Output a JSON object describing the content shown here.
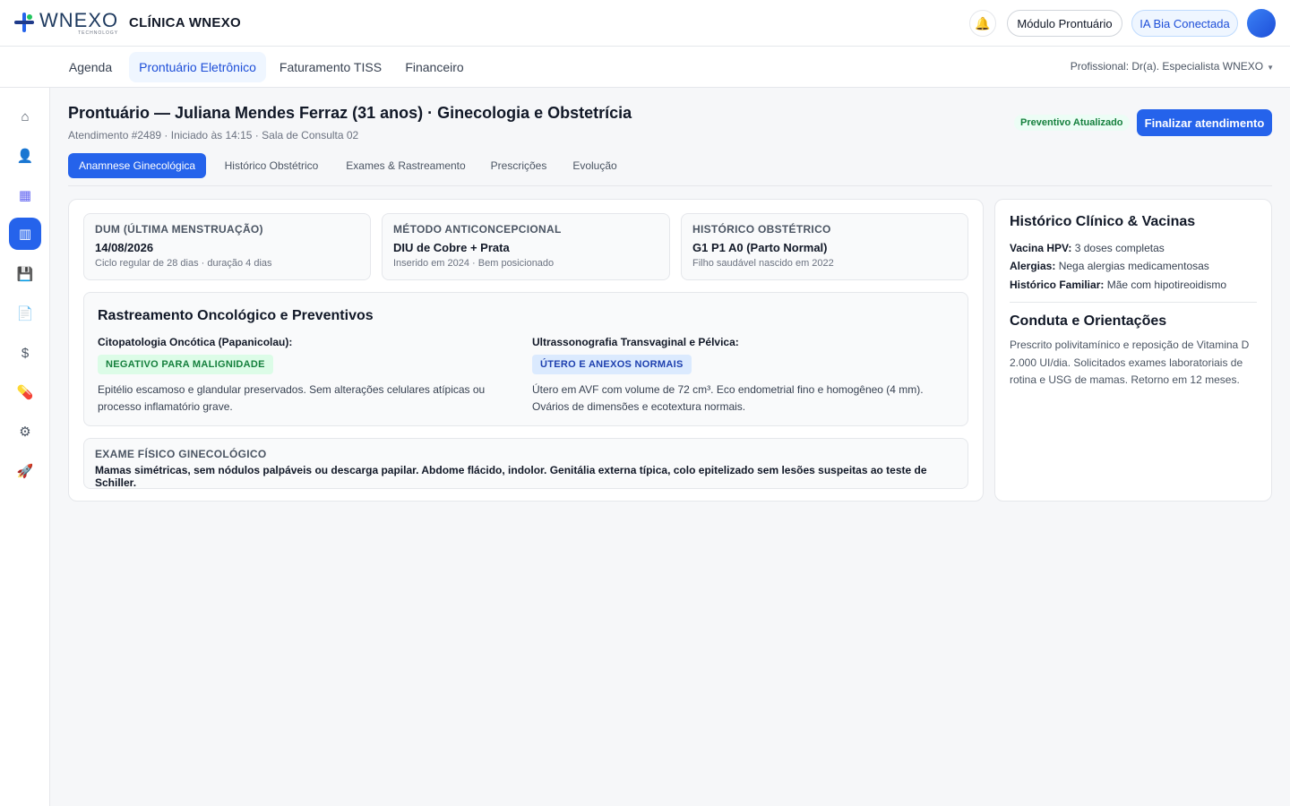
{
  "brand": {
    "logo_word": "WNEXO",
    "logo_sub": "TECHNOLOGY",
    "clinic": "CLÍNICA WNEXO"
  },
  "header": {
    "modulo_label": "Módulo Prontuário",
    "ia_label": "IA Bia Conectada"
  },
  "nav": {
    "items": [
      {
        "label": "Agenda"
      },
      {
        "label": "Prontuário Eletrônico"
      },
      {
        "label": "Faturamento TISS"
      },
      {
        "label": "Financeiro"
      }
    ],
    "profissional": "Profissional: Dr(a). Especialista WNEXO"
  },
  "sidebar": {
    "icons": [
      "home-icon",
      "patient-icon",
      "calendar-icon",
      "records-icon",
      "save-icon",
      "document-icon",
      "dollar-icon",
      "pill-icon",
      "gear-icon",
      "rocket-icon"
    ],
    "glyphs": [
      "⌂",
      "👤",
      "▦",
      "▥",
      "💾",
      "📄",
      "$",
      "💊",
      "⚙",
      "🚀"
    ]
  },
  "patient": {
    "title": "Prontuário — Juliana Mendes Ferraz (31 anos) · Ginecologia e Obstetrícia",
    "subtitle": "Atendimento #2489 · Iniciado às 14:15 · Sala de Consulta 02",
    "status_badge": "Preventivo Atualizado",
    "finalize_label": "Finalizar atendimento"
  },
  "tabs": [
    {
      "label": "Anamnese Ginecológica"
    },
    {
      "label": "Histórico Obstétrico"
    },
    {
      "label": "Exames & Rastreamento"
    },
    {
      "label": "Prescrições"
    },
    {
      "label": "Evolução"
    }
  ],
  "summary": [
    {
      "label": "DUM (Última Menstruação)",
      "value": "14/08/2026",
      "note": "Ciclo regular de 28 dias · duração 4 dias"
    },
    {
      "label": "Método Anticoncepcional",
      "value": "DIU de Cobre + Prata",
      "note": "Inserido em 2024 · Bem posicionado"
    },
    {
      "label": "Histórico Obstétrico",
      "value": "G1 P1 A0 (Parto Normal)",
      "note": "Filho saudável nascido em 2022"
    }
  ],
  "rastreio": {
    "title": "Rastreamento Oncológico e Preventivos",
    "exams": [
      {
        "name": "Citopatologia Oncótica (Papanicolau):",
        "result": "NEGATIVO PARA MALIGNIDADE",
        "result_color": "#15803d",
        "desc": "Epitélio escamoso e glandular preservados. Sem alterações celulares atípicas ou processo inflamatório grave."
      },
      {
        "name": "Ultrassonografia Transvaginal e Pélvica:",
        "result": "ÚTERO E ANEXOS NORMAIS",
        "result_color": "#1e40af",
        "desc": "Útero em AVF com volume de 72 cm³. Eco endometrial fino e homogêneo (4 mm). Ovários de dimensões e ecotextura normais."
      }
    ]
  },
  "exame_fisico": {
    "label": "Exame Físico Ginecológico",
    "text": "Mamas simétricas, sem nódulos palpáveis ou descarga papilar. Abdome flácido, indolor. Genitália externa típica, colo epitelizado sem lesões suspeitas ao teste de Schiller."
  },
  "side": {
    "historico_title": "Histórico Clínico & Vacinas",
    "rows": [
      {
        "key": "Vacina HPV:",
        "value": "3 doses completas"
      },
      {
        "key": "Alergias:",
        "value": "Nega alergias medicamentosas"
      },
      {
        "key": "Histórico Familiar:",
        "value": "Mãe com hipotireoidismo"
      }
    ],
    "conduta_title": "Conduta e Orientações",
    "conduta_text": "Prescrito polivitamínico e reposição de Vitamina D 2.000 UI/dia. Solicitados exames laboratoriais de rotina e USG de mamas. Retorno em 12 meses."
  },
  "colors": {
    "primary": "#2563eb",
    "success": "#15803d",
    "info": "#1e40af"
  }
}
